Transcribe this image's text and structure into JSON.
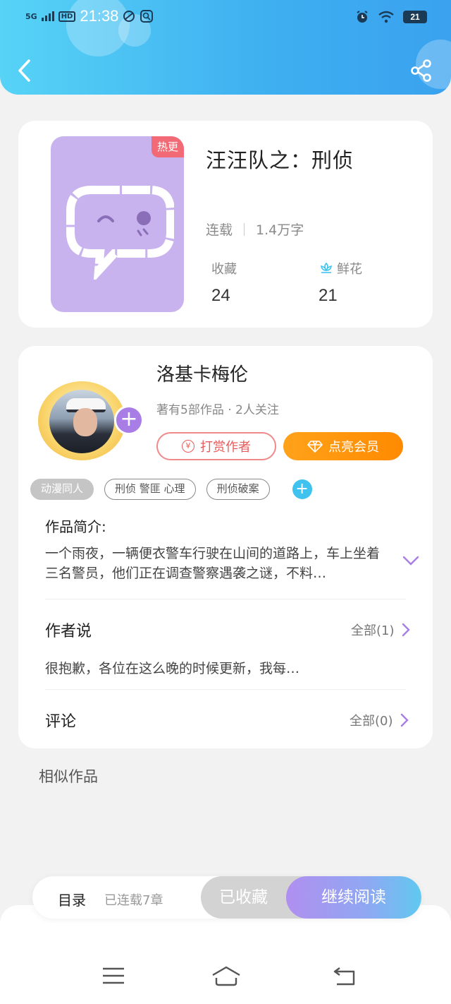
{
  "status_bar": {
    "network": "5G",
    "hd": "HD",
    "time": "21:38",
    "battery": "21"
  },
  "book": {
    "title": "汪汪队之：刑侦",
    "badge": "热更",
    "status": "连载",
    "word_count": "1.4万字",
    "favorites_label": "收藏",
    "favorites_value": "24",
    "flowers_label": "鲜花",
    "flowers_value": "21"
  },
  "author": {
    "name": "洛基卡梅伦",
    "meta": "著有5部作品 · 2人关注",
    "follow_symbol": "+",
    "tip_button": "打赏作者",
    "tip_symbol": "¥",
    "vip_button": "点亮会员",
    "tags": [
      "动漫同人",
      "刑侦 警匪 心理",
      "刑侦破案"
    ],
    "add_tag_symbol": "+"
  },
  "intro": {
    "title": "作品简介:",
    "text": "一个雨夜，一辆便衣警车行驶在山间的道路上，车上坐着三名警员，他们正在调查警察遇袭之谜，不料…"
  },
  "author_says": {
    "title": "作者说",
    "all_label": "全部(1)",
    "text": "很抱歉，各位在这么晚的时候更新，我每…"
  },
  "comments": {
    "title": "评论",
    "all_label": "全部(0)"
  },
  "similar": {
    "title": "相似作品"
  },
  "action_bar": {
    "toc": "目录",
    "chapters": "已连载7章",
    "saved": "已收藏",
    "continue": "继续阅读"
  },
  "colors": {
    "header_start": "#57d3f6",
    "header_end": "#3aa2ef",
    "cover_bg": "#c9b3ef",
    "accent_purple": "#a87de6",
    "vip_orange": "#ff8a00",
    "tip_red": "#ea5a5a",
    "tag_add_blue": "#3fc3ee"
  },
  "icons": {
    "back": "back-arrow-icon",
    "share": "share-icon",
    "flower": "flower-icon",
    "diamond": "diamond-icon",
    "expand": "chevron-down-icon",
    "more": "chevron-right-icon",
    "nav_menu": "menu-icon",
    "nav_home": "home-icon",
    "nav_back": "back-icon"
  }
}
